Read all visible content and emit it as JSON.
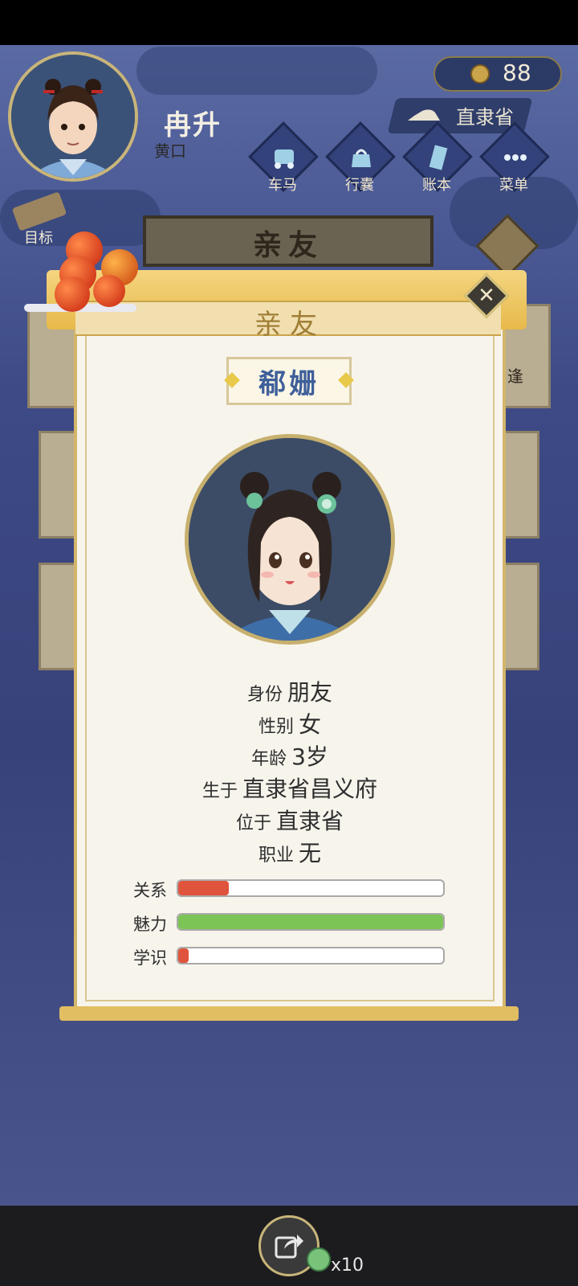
{
  "hud": {
    "player_name": "冉升",
    "player_rank": "黄口",
    "coins": "88",
    "location": "直隶省",
    "goal_label": "目标",
    "menu": [
      {
        "label": "车马"
      },
      {
        "label": "行囊"
      },
      {
        "label": "账本"
      },
      {
        "label": "菜单"
      }
    ]
  },
  "background_dialog": {
    "title": "亲友",
    "card_text": "逢"
  },
  "panel": {
    "title": "亲友",
    "person_name": "郗姗",
    "info": [
      {
        "key": "身份",
        "value": "朋友"
      },
      {
        "key": "性别",
        "value": "女"
      },
      {
        "key": "年龄",
        "value": "3岁"
      },
      {
        "key": "生于",
        "value": "直隶省昌义府"
      },
      {
        "key": "位于",
        "value": "直隶省"
      },
      {
        "key": "职业",
        "value": "无"
      }
    ],
    "stats": [
      {
        "label": "关系",
        "fraction": 0.19,
        "color": "#e0533c"
      },
      {
        "label": "魅力",
        "fraction": 1.0,
        "color": "#7cc455"
      },
      {
        "label": "学识",
        "fraction": 0.04,
        "color": "#e0533c"
      }
    ]
  },
  "footer": {
    "share_count": "x10"
  }
}
